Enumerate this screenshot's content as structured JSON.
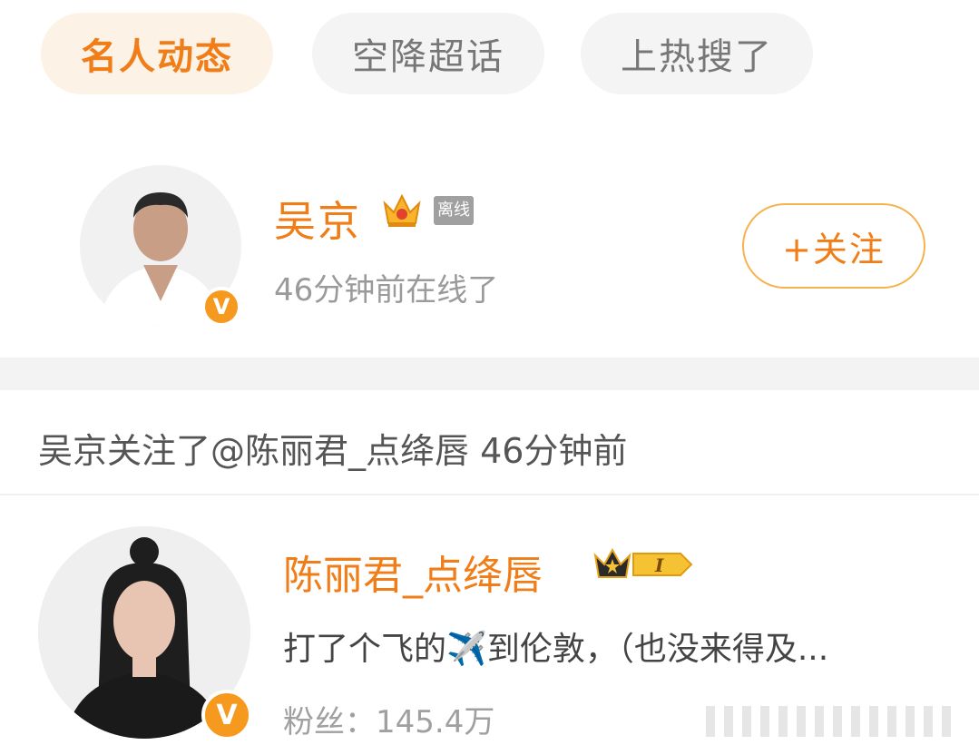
{
  "tabs": [
    {
      "label": "名人动态",
      "active": true
    },
    {
      "label": "空降超话",
      "active": false
    },
    {
      "label": "上热搜了",
      "active": false
    }
  ],
  "celebrity": {
    "name": "吴京",
    "status_tag": "离线",
    "online_time": "46分钟前在线了",
    "follow_label": "+关注",
    "verified_badge": "V"
  },
  "activity": {
    "text": "吴京关注了@陈丽君_点绛唇 46分钟前"
  },
  "followed_user": {
    "name": "陈丽君_点绛唇",
    "level_badge": "I",
    "post_preview": "打了个飞的✈️到伦敦，（也没来得及...",
    "fans": "粉丝：145.4万",
    "verified_badge": "V"
  },
  "colors": {
    "accent": "#f07d17",
    "tab_active_bg": "#fdf2e6",
    "tab_bg": "#f4f4f4",
    "muted_text": "#9a9a9a",
    "verified_badge": "#f59a1e"
  }
}
